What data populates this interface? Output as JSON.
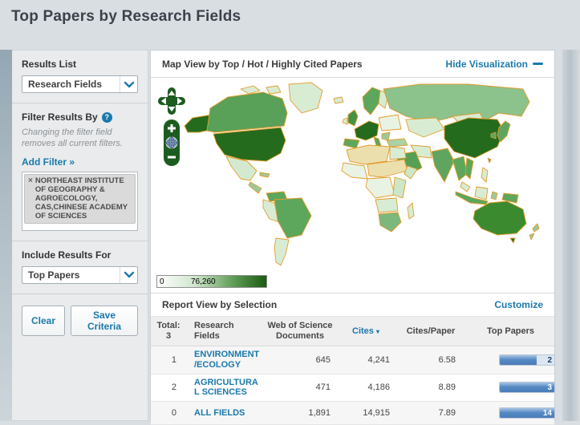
{
  "page_title": "Top Papers by Research Fields",
  "icons": {
    "help": "?",
    "remove": "×",
    "sort_down": "▾"
  },
  "sidebar": {
    "results_list": {
      "label": "Results List",
      "selected": "Research Fields"
    },
    "filter": {
      "label": "Filter Results By",
      "note": "Changing the filter field removes all current filters.",
      "add_filter_label": "Add Filter »",
      "chips": [
        {
          "text": "NORTHEAST INSTITUTE OF GEOGRAPHY & AGROECOLOGY, CAS,CHINESE ACADEMY OF SCIENCES"
        }
      ]
    },
    "include_results_for": {
      "label": "Include Results For",
      "selected": "Top Papers"
    },
    "buttons": {
      "clear": "Clear",
      "save": "Save Criteria"
    }
  },
  "map_panel": {
    "title": "Map View by Top / Hot / Highly Cited Papers",
    "hide_visualization_label": "Hide Visualization",
    "legend": {
      "min": "0",
      "max": "76,260"
    },
    "colors": {
      "map_high": "#256b1d",
      "map_mid": "#5ca75c",
      "map_low": "#d8ecd4",
      "map_none": "#ecdfae",
      "map_border": "#e29d2d"
    }
  },
  "report": {
    "title": "Report View by Selection",
    "customize_label": "Customize",
    "table": {
      "total_label": "Total:",
      "total_value": "3",
      "columns": [
        "Research Fields",
        "Web of Science Documents",
        "Cites",
        "Cites/Paper",
        "Top Papers"
      ],
      "rows": [
        {
          "rank": "1",
          "field": "ENVIRONMENT/ECOLOGY",
          "documents": "645",
          "cites": "4,241",
          "cites_per_paper": "6.58",
          "top_papers": "2",
          "bar_fill_pct": 67
        },
        {
          "rank": "2",
          "field": "AGRICULTURAL SCIENCES",
          "documents": "471",
          "cites": "4,186",
          "cites_per_paper": "8.89",
          "top_papers": "3",
          "bar_fill_pct": 100
        },
        {
          "rank": "0",
          "field": "ALL FIELDS",
          "documents": "1,891",
          "cites": "14,915",
          "cites_per_paper": "7.89",
          "top_papers": "14",
          "bar_fill_pct": 100
        }
      ]
    }
  },
  "colors": {
    "link": "#1a79ab",
    "bar_fill": "#5688c4",
    "bar_track": "#dce6f2"
  }
}
